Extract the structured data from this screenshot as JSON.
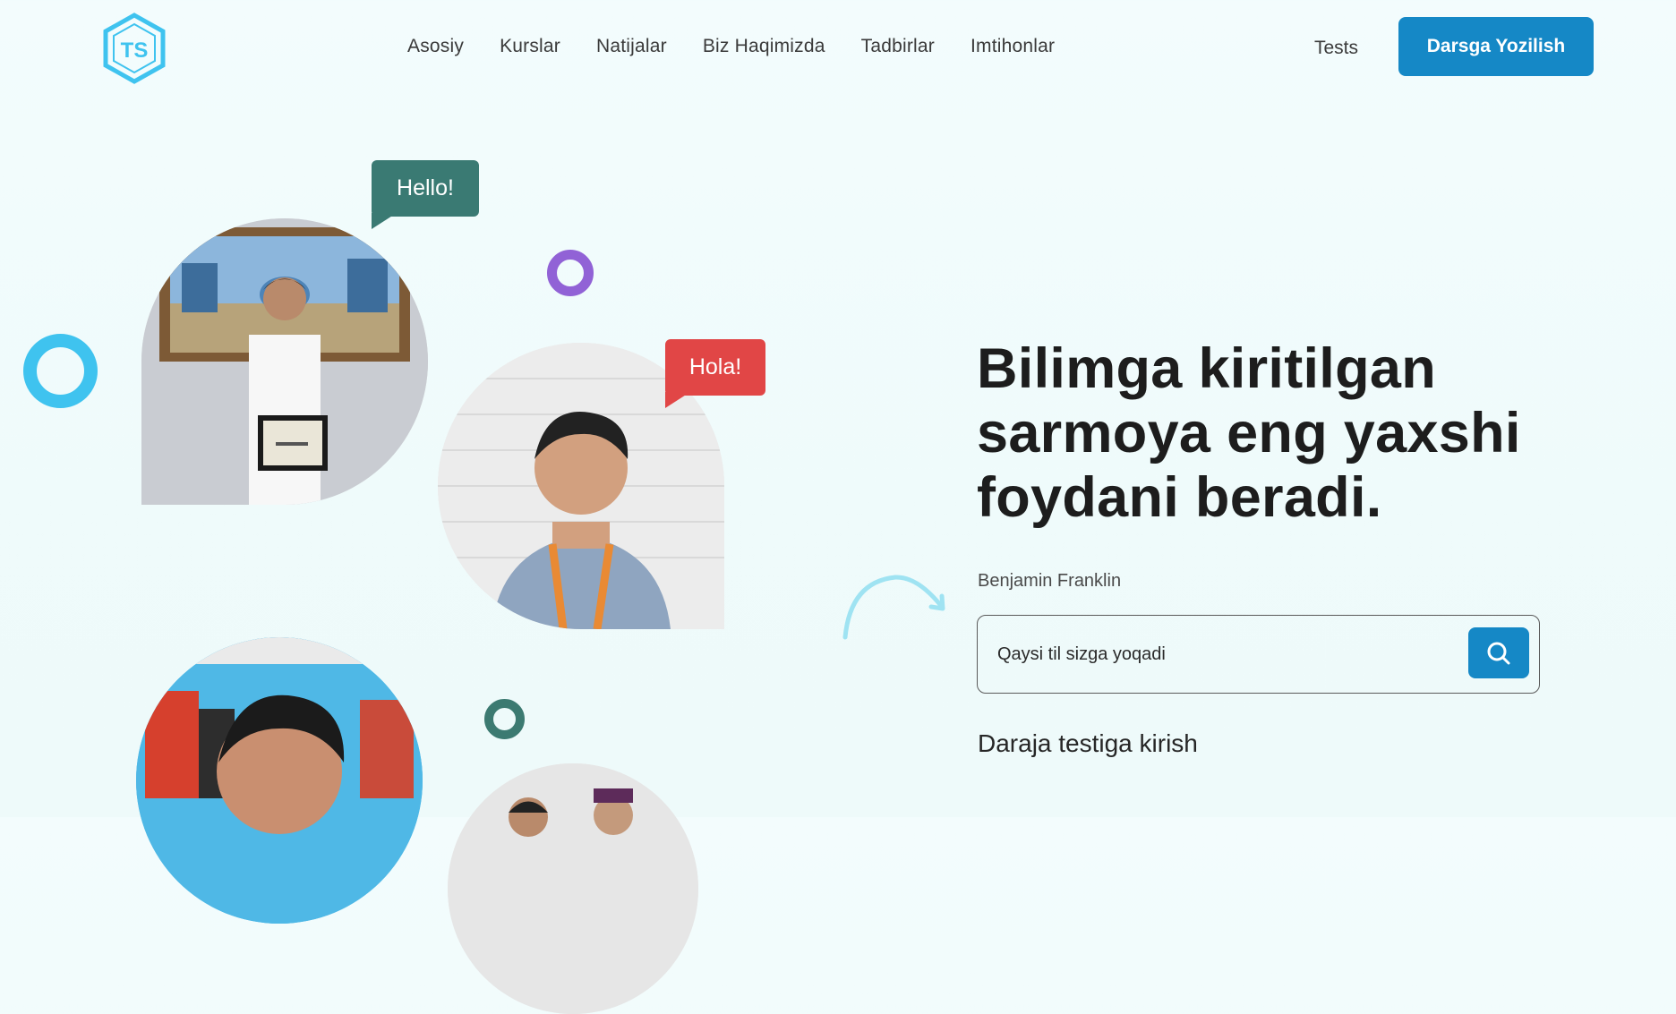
{
  "header": {
    "logo_text": "TS",
    "nav_items": [
      "Asosiy",
      "Kurslar",
      "Natijalar",
      "Biz Haqimizda",
      "Tadbirlar",
      "Imtihonlar"
    ],
    "tests_label": "Tests",
    "cta_label": "Darsga Yozilish"
  },
  "bubbles": {
    "hello": "Hello!",
    "hola": "Hola!"
  },
  "hero": {
    "title_lines": [
      "Bilimga kiritilgan",
      "sarmoya eng yaxshi",
      "foydani beradi."
    ],
    "author": "Benjamin Franklin",
    "search_placeholder": "Qaysi til sizga yoqadi",
    "level_test_label": "Daraja testiga kirish"
  },
  "icons": {
    "logo": "hexagon-logo-icon",
    "search": "search-icon",
    "arrow": "curved-arrow-icon"
  },
  "colors": {
    "primary": "#1588c6",
    "teal": "#3a7a73",
    "red": "#e14646",
    "purple": "#9162d6",
    "light_blue": "#3fc3ef"
  }
}
